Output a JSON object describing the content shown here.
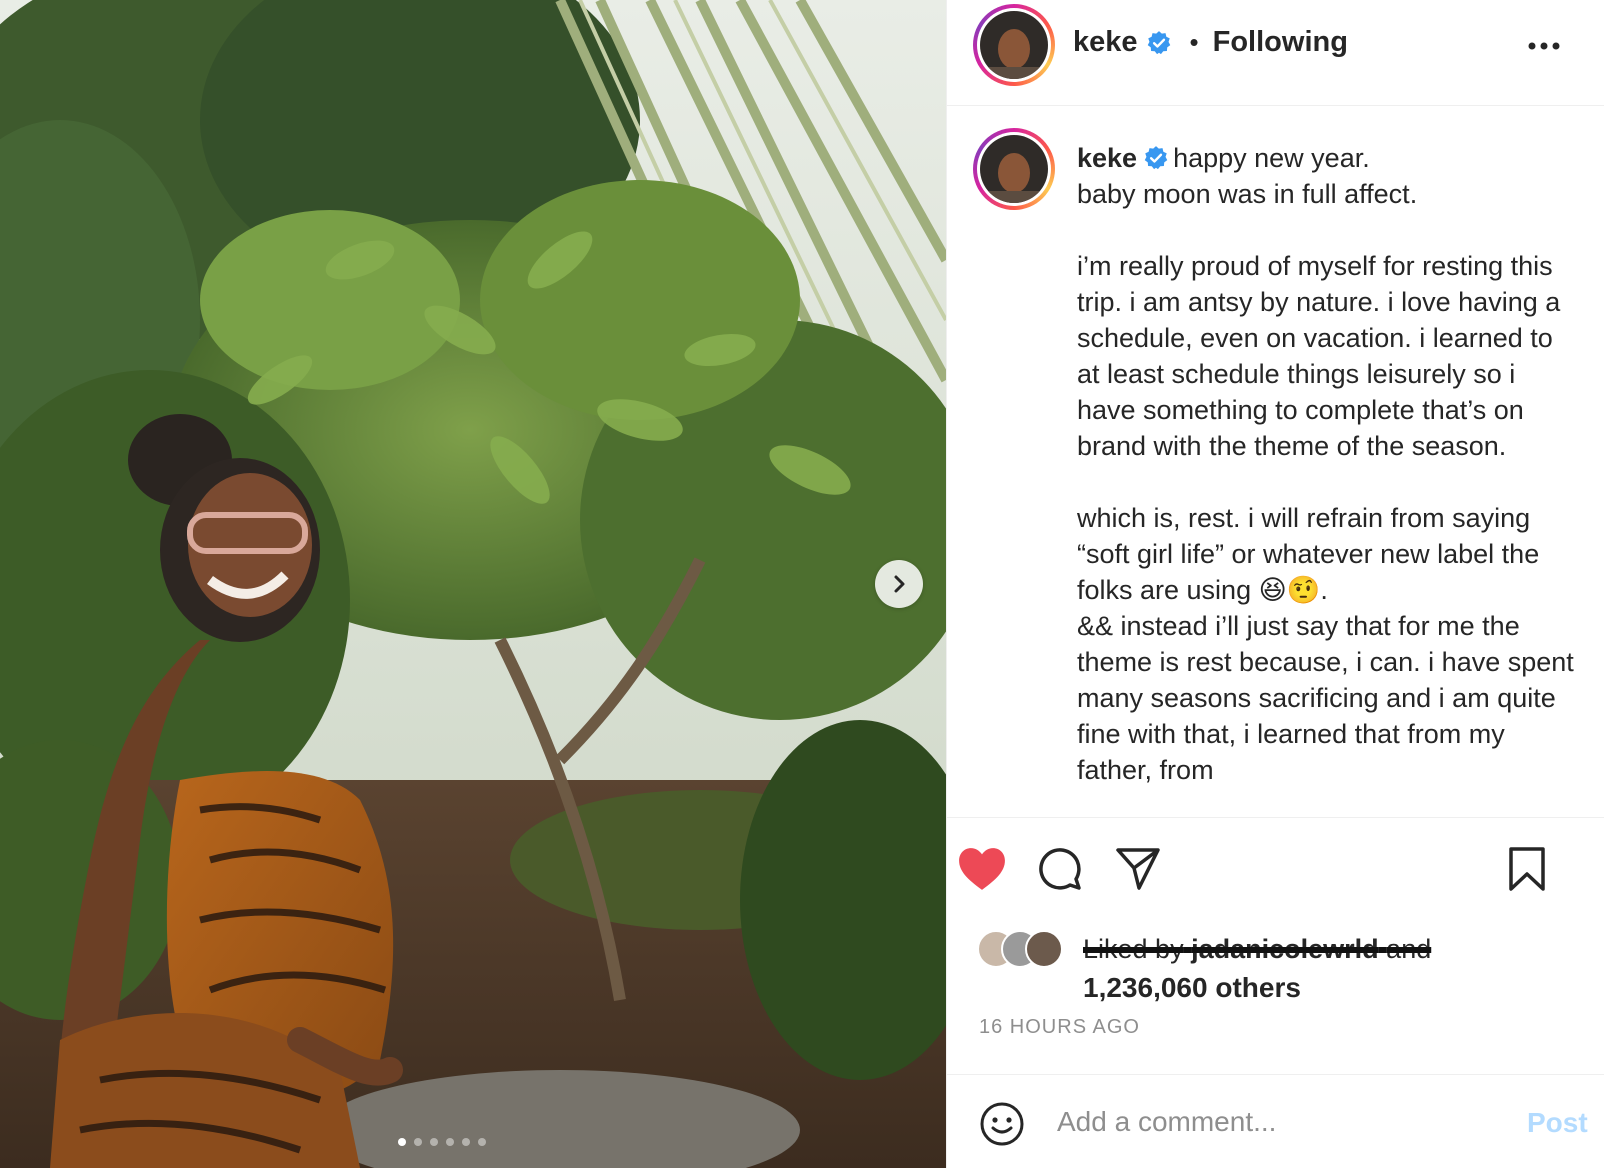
{
  "post": {
    "username": "keke",
    "follow_status": "Following",
    "separator": "•",
    "caption_text": "happy new year.\nbaby moon was in full affect.\n\ni’m really proud of myself for resting this trip. i am antsy by nature. i love having a schedule, even on vacation. i learned to at least schedule things leisurely so i have something to complete that’s on brand with the theme of the season.\n\nwhich is, rest. i will refrain from saying “soft girl life” or whatever new label the folks are using 😆🤨.\n&& instead i’ll just say that for me the theme is rest because, i can. i have spent many seasons sacrificing and i am quite fine with that, i learned that from my father, from",
    "liked_by_prefix": "Liked by",
    "liked_by_user": "jadanicolewrld",
    "liked_by_suffix": "and",
    "likes_count": "1,236,060 others",
    "timestamp": "16 HOURS AGO",
    "carousel": {
      "total": 6,
      "current": 1
    }
  },
  "comment": {
    "placeholder": "Add a comment...",
    "post_label": "Post"
  },
  "colors": {
    "heart": "#ed4956",
    "verified": "#3897f0",
    "post_disabled": "#b3dbff"
  },
  "icons": [
    "more-options-icon",
    "heart-icon",
    "comment-icon",
    "share-icon",
    "bookmark-icon",
    "emoji-icon",
    "chevron-right-icon",
    "verified-badge-icon"
  ]
}
